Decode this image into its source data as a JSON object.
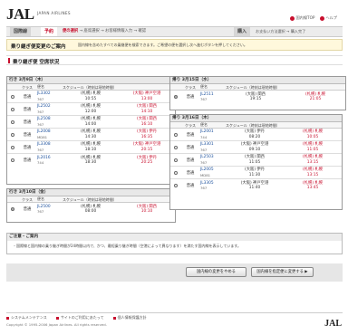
{
  "header": {
    "logo": "JAL",
    "brand_name": "JAPAN AIRLINES",
    "links": [
      "国内線TOP",
      "ヘルプ"
    ]
  },
  "nav": {
    "tab1": "国際線",
    "tab2": "予約",
    "steps_current": "便の選択",
    "steps_rest": "→ 座席選択 → お客様情報入力 → 確認",
    "tab3": "購入",
    "steps2": "お支払い方法選択 → 購入完了"
  },
  "guide": {
    "title": "乗り継ぎ便変更のご案内",
    "text": "国内線を含めたすべての乗継便を検索できます。ご希望の便を選択し次へ進むボタンを押してください。"
  },
  "section_title": "乗り継ぎ便 空席状況",
  "columns": {
    "select": "",
    "class": "クラス",
    "flight": "便名",
    "schedule": "スケジュール（時刻は現地時間）"
  },
  "panels": {
    "left_top": {
      "title": "行き 3月9日（木）",
      "rows": [
        {
          "cls": "普通",
          "no": "JL3302",
          "ac": "767",
          "dep": "(札幌) 札幌",
          "dep_t": "10:55",
          "arr": "(大阪) 神戸空港",
          "arr_t": "13:00",
          "on": false
        },
        {
          "cls": "普通",
          "no": "JL2502",
          "ac": "767",
          "dep": "(札幌) 札幌",
          "dep_t": "12:00",
          "arr": "(大阪) 関西",
          "arr_t": "14:10",
          "on": false
        },
        {
          "cls": "普通",
          "no": "JL2508",
          "ac": "767",
          "dep": "(札幌) 札幌",
          "dep_t": "14:00",
          "arr": "(大阪) 関西",
          "arr_t": "16:10",
          "on": false
        },
        {
          "cls": "普通",
          "no": "JL2008",
          "ac": "MD81",
          "dep": "(札幌) 札幌",
          "dep_t": "14:30",
          "arr": "(大阪) 伊丹",
          "arr_t": "16:35",
          "on": false
        },
        {
          "cls": "普通",
          "no": "JL3308",
          "ac": "767",
          "dep": "(札幌) 札幌",
          "dep_t": "18:10",
          "arr": "(大阪) 神戸空港",
          "arr_t": "20:15",
          "on": false
        },
        {
          "cls": "普通",
          "no": "JL2016",
          "ac": "744",
          "dep": "(札幌) 札幌",
          "dep_t": "18:30",
          "arr": "(大阪) 伊丹",
          "arr_t": "20:25",
          "on": false
        }
      ]
    },
    "left_bottom": {
      "title": "行き 3月10日（金）",
      "rows": [
        {
          "cls": "普通",
          "no": "JL2500",
          "ac": "767",
          "dep": "(札幌) 札幌",
          "dep_t": "08:00",
          "arr": "(大阪) 関西",
          "arr_t": "10:10",
          "on": true
        }
      ]
    },
    "right_top": {
      "title": "帰り 3月15日（水）",
      "rows": [
        {
          "cls": "普通",
          "no": "JL2511",
          "ac": "767",
          "dep": "(大阪) 関西",
          "dep_t": "19:15",
          "arr": "(札幌) 札幌",
          "arr_t": "21:05",
          "on": true
        }
      ]
    },
    "right_bottom": {
      "title": "帰り 3月16日（木）",
      "rows": [
        {
          "cls": "普通",
          "no": "JL2001",
          "ac": "744",
          "dep": "(大阪) 伊丹",
          "dep_t": "08:20",
          "arr": "(札幌) 札幌",
          "arr_t": "10:05",
          "on": false
        },
        {
          "cls": "普通",
          "no": "JL3301",
          "ac": "767",
          "dep": "(大阪) 神戸空港",
          "dep_t": "09:10",
          "arr": "(札幌) 札幌",
          "arr_t": "11:05",
          "on": false
        },
        {
          "cls": "普通",
          "no": "JL2503",
          "ac": "767",
          "dep": "(大阪) 関西",
          "dep_t": "11:05",
          "arr": "(札幌) 札幌",
          "arr_t": "13:15",
          "on": false
        },
        {
          "cls": "普通",
          "no": "JL2005",
          "ac": "MD81",
          "dep": "(大阪) 伊丹",
          "dep_t": "11:30",
          "arr": "(札幌) 札幌",
          "arr_t": "13:15",
          "on": false
        },
        {
          "cls": "普通",
          "no": "JL3305",
          "ac": "767",
          "dep": "(大阪) 神戸空港",
          "dep_t": "11:40",
          "arr": "(札幌) 札幌",
          "arr_t": "13:45",
          "on": false
        }
      ]
    }
  },
  "notice": {
    "title": "ご注意・ご案内",
    "text": "・国際線と国内線の乗り継ぎ時間が24時間以内で、かつ、最短乗り継ぎ時間（空港によって異なります）を満たす国内線を表示しています。"
  },
  "buttons": {
    "back": "国内線の変更をやめる",
    "next": "国内線を指定便に変更する ▶"
  },
  "footer": {
    "links": [
      "システムメンテナンス",
      "サイトのご利用にあたって",
      "個人情報保護方針"
    ],
    "copyright": "Copyright © 1995-2006 Japan Airlines. All rights reserved.",
    "logo": "JAL"
  },
  "colors": {
    "brand_red": "#c8102e"
  }
}
